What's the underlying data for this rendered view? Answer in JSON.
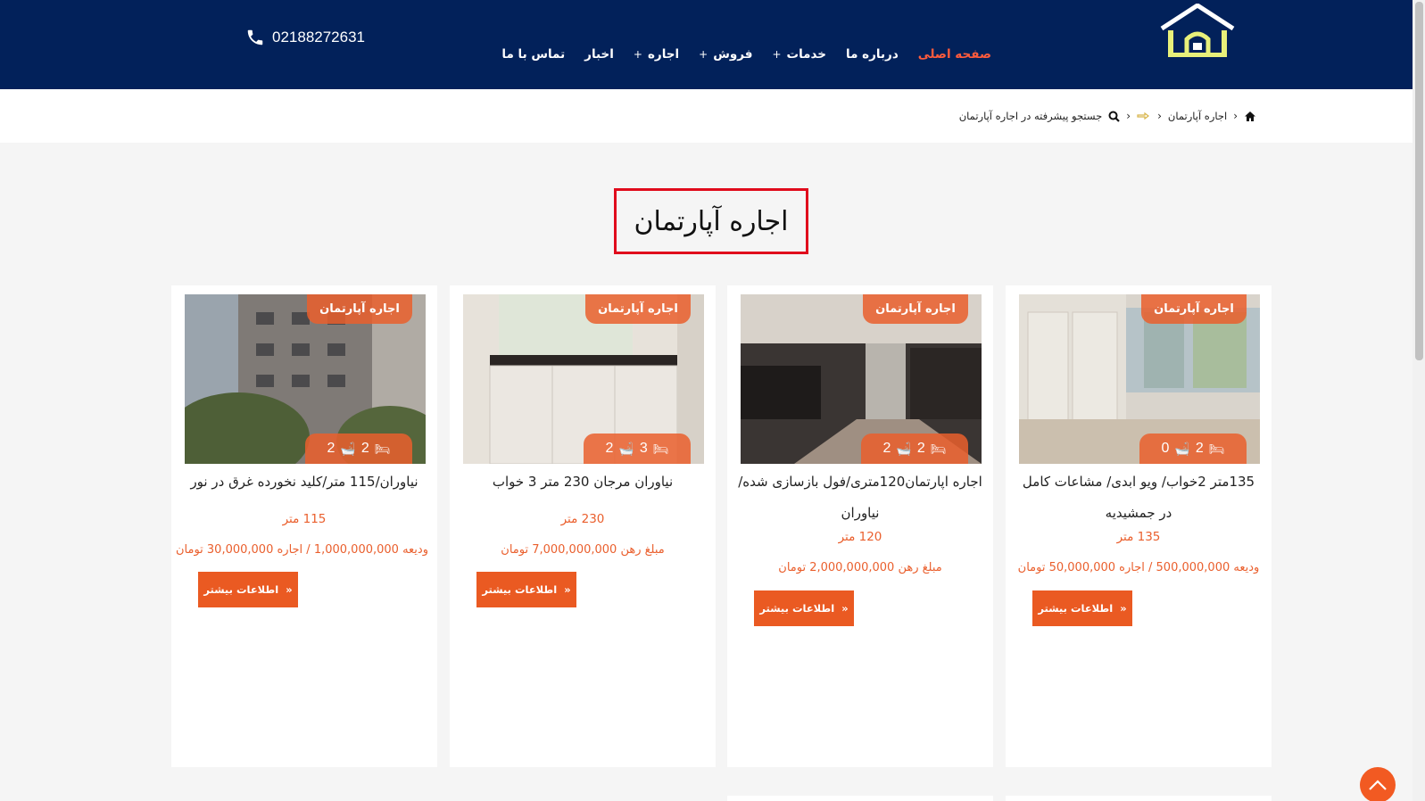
{
  "header": {
    "phone": "02188272631",
    "nav": [
      {
        "label": "صفحه اصلی",
        "active": true,
        "plus": false
      },
      {
        "label": "درباره ما",
        "active": false,
        "plus": false
      },
      {
        "label": "خدمات",
        "active": false,
        "plus": true
      },
      {
        "label": "فروش",
        "active": false,
        "plus": true
      },
      {
        "label": "اجاره",
        "active": false,
        "plus": true
      },
      {
        "label": "اخبار",
        "active": false,
        "plus": false
      },
      {
        "label": "تماس با ما",
        "active": false,
        "plus": false
      }
    ],
    "nav_plus_symbol": "+"
  },
  "breadcrumb": {
    "category": "اجاره آپارتمان",
    "search": "جستجو پیشرفته در اجاره آپارتمان",
    "separator": "›"
  },
  "page_title": "اجاره آپارتمان",
  "cards": [
    {
      "tag": "اجاره آپارتمان",
      "bedrooms": "2",
      "bathrooms": "0",
      "title": "135متر 2خواب/ ویو ابدی/ مشاعات کامل در جمشیدیه",
      "area": "135 متر",
      "price": "ودیعه 500,000,000 / اجاره 50,000,000  تومان",
      "button": "اطلاعات بیشتر"
    },
    {
      "tag": "اجاره آپارتمان",
      "bedrooms": "2",
      "bathrooms": "2",
      "title": "اجاره اپارتمان120متری/فول بازسازی شده/نیاوران",
      "area": "120 متر",
      "price": "مبلغ رهن 2,000,000,000 تومان",
      "button": "اطلاعات بیشتر"
    },
    {
      "tag": "اجاره آپارتمان",
      "bedrooms": "3",
      "bathrooms": "2",
      "title": "نیاوران مرجان 230 متر 3 خواب",
      "area": "230 متر",
      "price": "مبلغ رهن 7,000,000,000 تومان",
      "button": "اطلاعات بیشتر"
    },
    {
      "tag": "اجاره آپارتمان",
      "bedrooms": "2",
      "bathrooms": "2",
      "title": "نیاوران/115 متر/کلید نخورده غرق در نور",
      "area": "115 متر",
      "price": "ودیعه 1,000,000,000 / اجاره 30,000,000  تومان",
      "button": "اطلاعات بیشتر"
    }
  ],
  "colors": {
    "header_bg": "#02215a",
    "accent": "#ea5a22",
    "active_nav": "#ff5b3c",
    "title_border": "#e00b1c",
    "logo": "#e8f07a"
  },
  "icons": [
    "phone-icon",
    "home-icon",
    "search-icon",
    "bed-icon",
    "bath-icon",
    "double-chevron-icon",
    "chevron-up-icon"
  ]
}
